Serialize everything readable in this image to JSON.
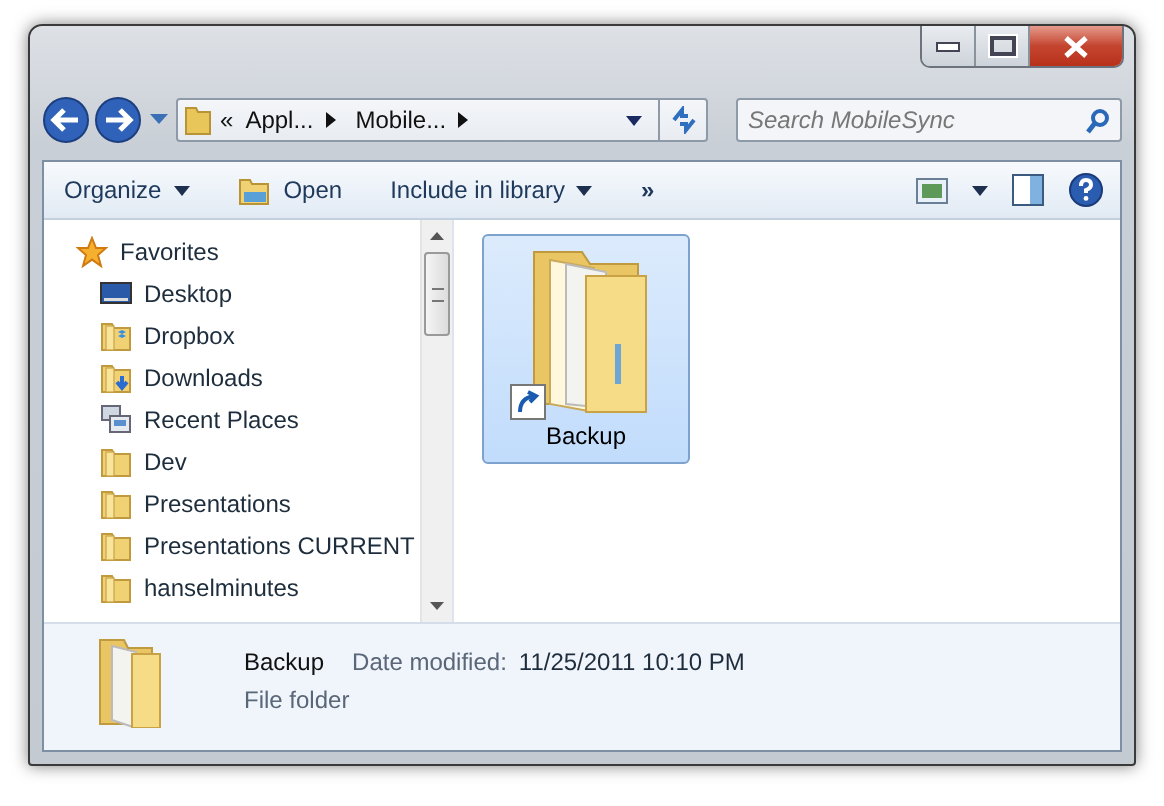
{
  "breadcrumb": {
    "prefix": "«",
    "segments": [
      "Appl...",
      "Mobile..."
    ]
  },
  "search": {
    "placeholder": "Search MobileSync"
  },
  "toolbar": {
    "items": [
      {
        "label": "Organize",
        "kind": "menu"
      },
      {
        "label": "Open",
        "kind": "open"
      },
      {
        "label": "Include in library",
        "kind": "menu"
      },
      {
        "label": "»",
        "kind": "more"
      }
    ]
  },
  "sidebar": {
    "items": [
      {
        "label": "Favorites",
        "kind": "star",
        "header": true
      },
      {
        "label": "Desktop",
        "kind": "desktop",
        "header": false
      },
      {
        "label": "Dropbox",
        "kind": "dropbox",
        "header": false
      },
      {
        "label": "Downloads",
        "kind": "downloads",
        "header": false
      },
      {
        "label": "Recent Places",
        "kind": "recent",
        "header": false
      },
      {
        "label": "Dev",
        "kind": "folder",
        "header": false
      },
      {
        "label": "Presentations",
        "kind": "folder",
        "header": false
      },
      {
        "label": "Presentations CURRENT",
        "kind": "folder",
        "header": false
      },
      {
        "label": "hanselminutes",
        "kind": "folder",
        "header": false
      }
    ]
  },
  "files": [
    {
      "name": "Backup",
      "shortcut": true,
      "selected": true
    }
  ],
  "details": {
    "name": "Backup",
    "type": "File folder",
    "date_label": "Date modified:",
    "date_value": "11/25/2011 10:10 PM"
  }
}
